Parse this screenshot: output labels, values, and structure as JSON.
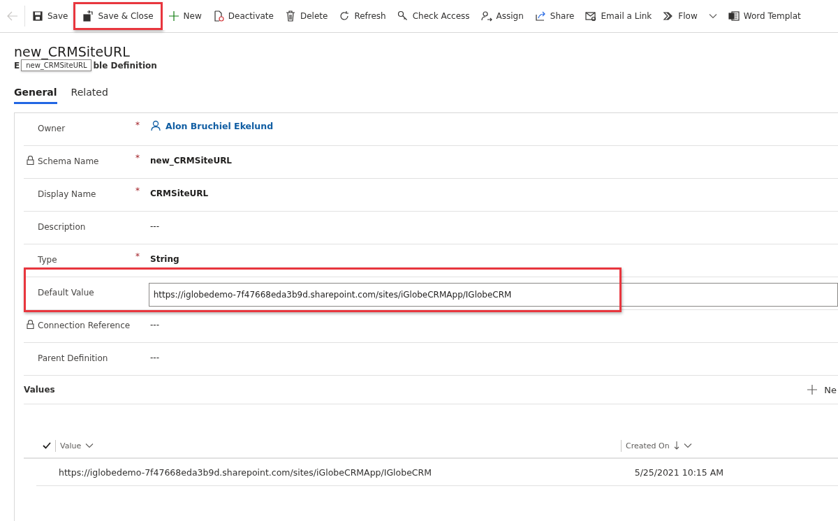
{
  "toolbar": {
    "back_disabled": true,
    "items": [
      {
        "label": "Save",
        "highlighted": false,
        "dropdown": false
      },
      {
        "label": "Save & Close",
        "highlighted": true,
        "dropdown": false
      },
      {
        "label": "New",
        "highlighted": false,
        "dropdown": false
      },
      {
        "label": "Deactivate",
        "highlighted": false,
        "dropdown": false
      },
      {
        "label": "Delete",
        "highlighted": false,
        "dropdown": false
      },
      {
        "label": "Refresh",
        "highlighted": false,
        "dropdown": false
      },
      {
        "label": "Check Access",
        "highlighted": false,
        "dropdown": false
      },
      {
        "label": "Assign",
        "highlighted": false,
        "dropdown": false
      },
      {
        "label": "Share",
        "highlighted": false,
        "dropdown": false
      },
      {
        "label": "Email a Link",
        "highlighted": false,
        "dropdown": false
      },
      {
        "label": "Flow",
        "highlighted": false,
        "dropdown": true
      },
      {
        "label": "Word Templat",
        "highlighted": false,
        "dropdown": false
      }
    ]
  },
  "header": {
    "title": "new_CRMSiteURL",
    "subtitle_parts": [
      "E",
      "ble Definition"
    ],
    "tooltip": "new_CRMSiteURL"
  },
  "tabs": [
    {
      "label": "General",
      "selected": true
    },
    {
      "label": "Related",
      "selected": false
    }
  ],
  "fields": [
    {
      "kind": "lookup",
      "label": "Owner",
      "required_mark": "*",
      "locked": false,
      "highlighted": false,
      "value": "Alon Bruchiel Ekelund"
    },
    {
      "kind": "text",
      "label": "Schema Name",
      "required_mark": "*",
      "locked": true,
      "highlighted": false,
      "value": "new_CRMSiteURL"
    },
    {
      "kind": "text",
      "label": "Display Name",
      "required_mark": "*",
      "locked": false,
      "highlighted": false,
      "value": "CRMSiteURL"
    },
    {
      "kind": "text",
      "label": "Description",
      "locked": false,
      "highlighted": false,
      "value": "---"
    },
    {
      "kind": "text",
      "label": "Type",
      "required_mark": "*",
      "locked": false,
      "highlighted": false,
      "value": "String"
    },
    {
      "kind": "input",
      "label": "Default Value",
      "locked": false,
      "highlighted": true,
      "value": "https://iglobedemo-7f47668eda3b9d.sharepoint.com/sites/iGlobeCRMApp/IGlobeCRM"
    },
    {
      "kind": "text",
      "label": "Connection Reference",
      "locked": true,
      "highlighted": false,
      "value": "---"
    },
    {
      "kind": "text",
      "label": "Parent Definition",
      "locked": false,
      "highlighted": false,
      "value": "---"
    }
  ],
  "values_section": {
    "title": "Values",
    "new_button": "Ne",
    "grid": {
      "columns": [
        {
          "label": "Value",
          "sorted": false
        },
        {
          "label": "Created On",
          "sorted": true
        }
      ],
      "rows": [
        [
          "https://iglobedemo-7f47668eda3b9d.sharepoint.com/sites/iGlobeCRMApp/IGlobeCRM",
          "5/25/2021 10:15 AM"
        ]
      ]
    }
  }
}
